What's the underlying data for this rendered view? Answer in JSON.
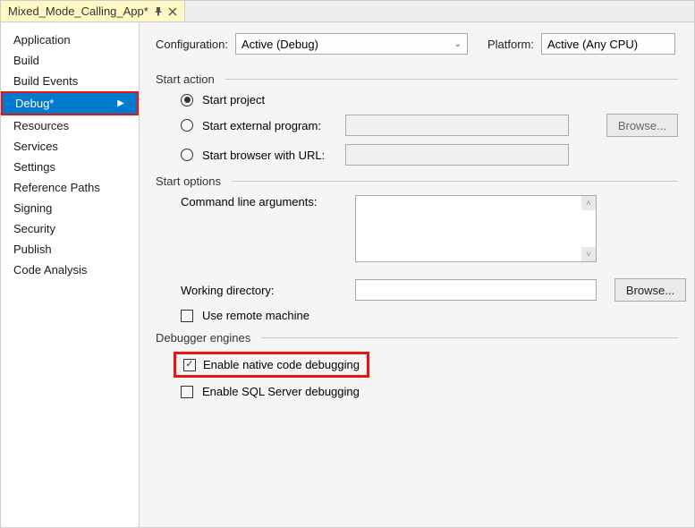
{
  "tab": {
    "title": "Mixed_Mode_Calling_App*"
  },
  "sidebar": {
    "items": [
      {
        "label": "Application"
      },
      {
        "label": "Build"
      },
      {
        "label": "Build Events"
      },
      {
        "label": "Debug*",
        "selected": true
      },
      {
        "label": "Resources"
      },
      {
        "label": "Services"
      },
      {
        "label": "Settings"
      },
      {
        "label": "Reference Paths"
      },
      {
        "label": "Signing"
      },
      {
        "label": "Security"
      },
      {
        "label": "Publish"
      },
      {
        "label": "Code Analysis"
      }
    ]
  },
  "top": {
    "config_label": "Configuration:",
    "config_value": "Active (Debug)",
    "platform_label": "Platform:",
    "platform_value": "Active (Any CPU)"
  },
  "sections": {
    "start_action": {
      "title": "Start action",
      "start_project": "Start project",
      "start_external": "Start external program:",
      "start_browser": "Start browser with URL:",
      "browse": "Browse..."
    },
    "start_options": {
      "title": "Start options",
      "cli_args": "Command line arguments:",
      "working_dir": "Working directory:",
      "browse": "Browse...",
      "remote": "Use remote machine"
    },
    "debugger": {
      "title": "Debugger engines",
      "native": "Enable native code debugging",
      "sql": "Enable SQL Server debugging"
    }
  }
}
